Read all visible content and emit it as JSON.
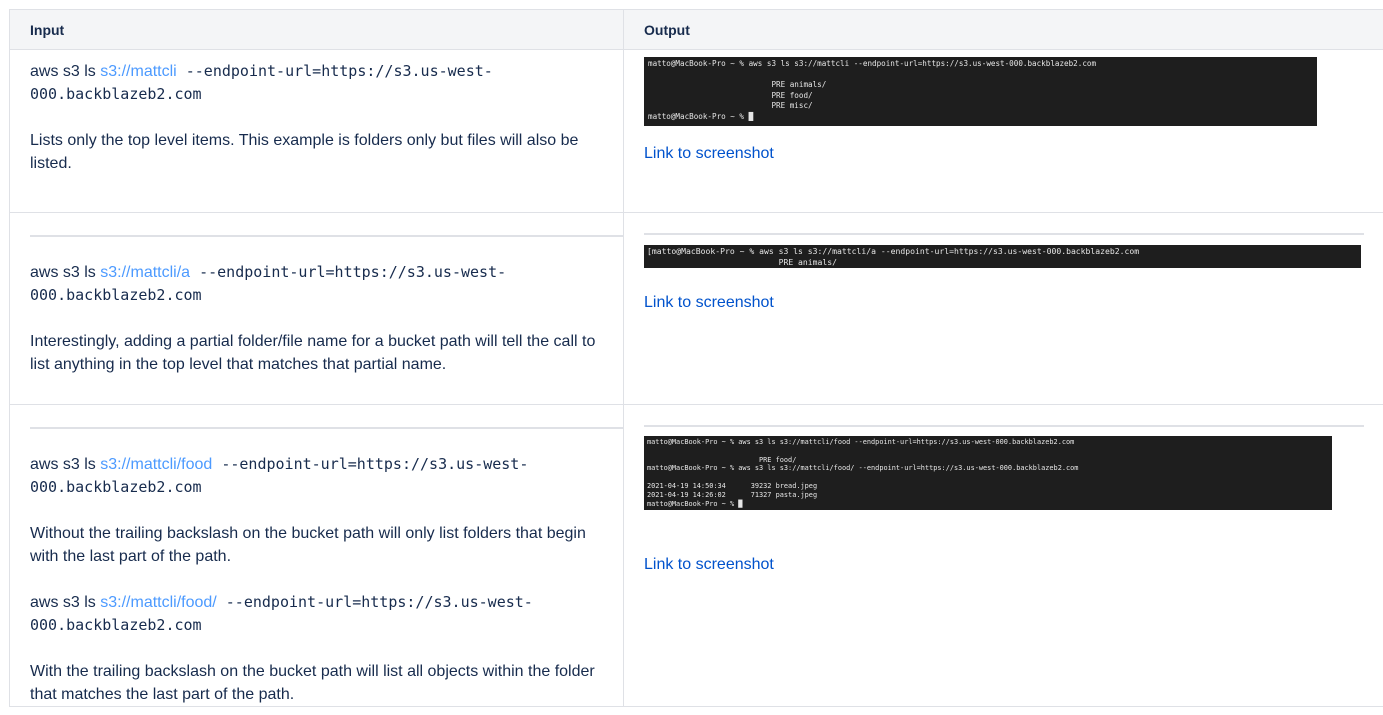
{
  "table": {
    "headers": {
      "input": "Input",
      "output": "Output"
    }
  },
  "rows": [
    {
      "commands": [
        {
          "prefix": "aws s3 ls ",
          "bucket": "s3://mattcli",
          "flags": " --endpoint-url=https://s3.us-west-000.backblazeb2.com"
        }
      ],
      "descriptions": [
        "Lists only the top level items. This example is folders only but files will also be listed."
      ],
      "terminal_lines": [
        "matto@MacBook-Pro ~ % aws s3 ls s3://mattcli --endpoint-url=https://s3.us-west-000.backblazeb2.com",
        "",
        "                           PRE animals/",
        "                           PRE food/",
        "                           PRE misc/",
        "matto@MacBook-Pro ~ % █"
      ],
      "link_text": "Link to screenshot"
    },
    {
      "commands": [
        {
          "prefix": "aws s3 ls ",
          "bucket": "s3://mattcli/a",
          "flags": " --endpoint-url=https://s3.us-west-000.backblazeb2.com"
        }
      ],
      "descriptions": [
        "Interestingly, adding a partial folder/file name for a bucket path will tell the call to list anything in the top level that matches that partial name."
      ],
      "terminal_lines": [
        "[matto@MacBook-Pro ~ % aws s3 ls s3://mattcli/a --endpoint-url=https://s3.us-west-000.backblazeb2.com",
        "                           PRE animals/"
      ],
      "link_text": "Link to screenshot"
    },
    {
      "commands": [
        {
          "prefix": "aws s3 ls ",
          "bucket": "s3://mattcli/food",
          "flags": " --endpoint-url=https://s3.us-west-000.backblazeb2.com"
        },
        {
          "prefix": "aws s3 ls ",
          "bucket": "s3://mattcli/food/",
          "flags": " --endpoint-url=https://s3.us-west-000.backblazeb2.com"
        }
      ],
      "descriptions": [
        "Without the trailing backslash on the bucket path will only list folders that begin with the last part of the path.",
        "With the trailing backslash on the bucket path will list all objects within the folder that matches the last part of the path."
      ],
      "terminal_lines": [
        "matto@MacBook-Pro ~ % aws s3 ls s3://mattcli/food --endpoint-url=https://s3.us-west-000.backblazeb2.com",
        "",
        "                           PRE food/",
        "matto@MacBook-Pro ~ % aws s3 ls s3://mattcli/food/ --endpoint-url=https://s3.us-west-000.backblazeb2.com",
        "",
        "2021-04-19 14:50:34      39232 bread.jpeg",
        "2021-04-19 14:26:02      71327 pasta.jpeg",
        "matto@MacBook-Pro ~ % █"
      ],
      "link_text": "Link to screenshot"
    }
  ],
  "colors": {
    "link": "#0052cc",
    "bucket_link": "#4c9aff",
    "header_bg": "#f4f5f7",
    "border": "#dfe1e6",
    "terminal_bg": "#1e1e1e"
  }
}
